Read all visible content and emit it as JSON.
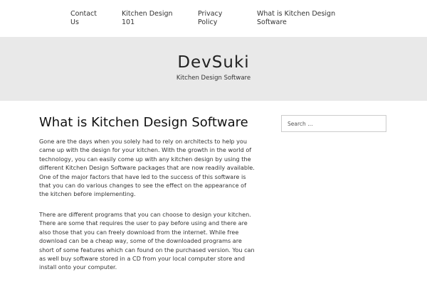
{
  "nav": {
    "items": [
      {
        "label": "Contact\nUs"
      },
      {
        "label": "Kitchen Design\n101"
      },
      {
        "label": "Privacy\nPolicy"
      },
      {
        "label": "What is Kitchen Design\nSoftware"
      }
    ]
  },
  "header": {
    "site_title": "DevSuki",
    "tagline": "Kitchen Design Software"
  },
  "post": {
    "title": "What is Kitchen Design Software",
    "paragraphs": [
      "Gone are the days when you solely had to rely on architects to help you came up with the design for your kitchen. With the growth in the world of technology, you can easily come up with any kitchen design by using the different Kitchen Design Software packages that are now readily available. One of the major factors that have led to the success of this software is that you can do various changes to see the effect on the appearance of the kitchen before implementing.",
      "There are different programs that you can choose to design your kitchen. There are some that requires the user to pay before using and there are also those that you can freely download from the internet. While free download can be a cheap way, some of the downloaded programs are short of some features which can found on the purchased version. You can as well buy software stored in a CD from your local computer store and install onto your computer."
    ]
  },
  "sidebar": {
    "search": {
      "placeholder": "Search …"
    }
  }
}
